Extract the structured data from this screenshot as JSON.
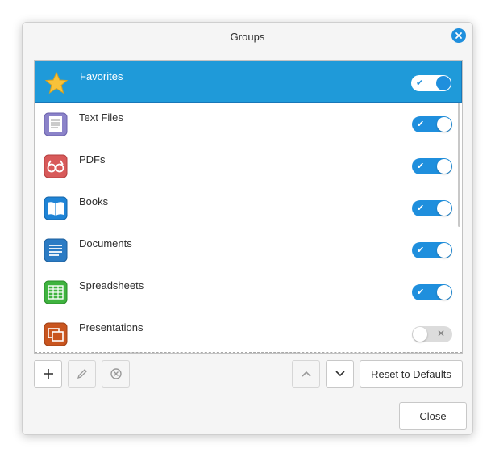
{
  "dialog": {
    "title": "Groups",
    "close_icon": "close-icon"
  },
  "groups": [
    {
      "label": "Favorites",
      "icon": "star-icon",
      "enabled": true,
      "selected": true
    },
    {
      "label": "Text Files",
      "icon": "text-file-icon",
      "enabled": true,
      "selected": false
    },
    {
      "label": "PDFs",
      "icon": "pdf-glasses-icon",
      "enabled": true,
      "selected": false
    },
    {
      "label": "Books",
      "icon": "book-icon",
      "enabled": true,
      "selected": false
    },
    {
      "label": "Documents",
      "icon": "document-icon",
      "enabled": true,
      "selected": false
    },
    {
      "label": "Spreadsheets",
      "icon": "spreadsheet-icon",
      "enabled": true,
      "selected": false
    },
    {
      "label": "Presentations",
      "icon": "presentation-icon",
      "enabled": false,
      "selected": false
    }
  ],
  "toolbar": {
    "add_icon": "plus-icon",
    "edit_icon": "pencil-icon",
    "remove_icon": "remove-circle-icon",
    "move_up_icon": "chevron-up-icon",
    "move_down_icon": "chevron-down-icon",
    "reset_label": "Reset to Defaults"
  },
  "footer": {
    "close_label": "Close"
  },
  "colors": {
    "accent": "#1f9ad9",
    "toggle_on": "#1f8fdd",
    "toggle_off": "#dcdcdc"
  }
}
